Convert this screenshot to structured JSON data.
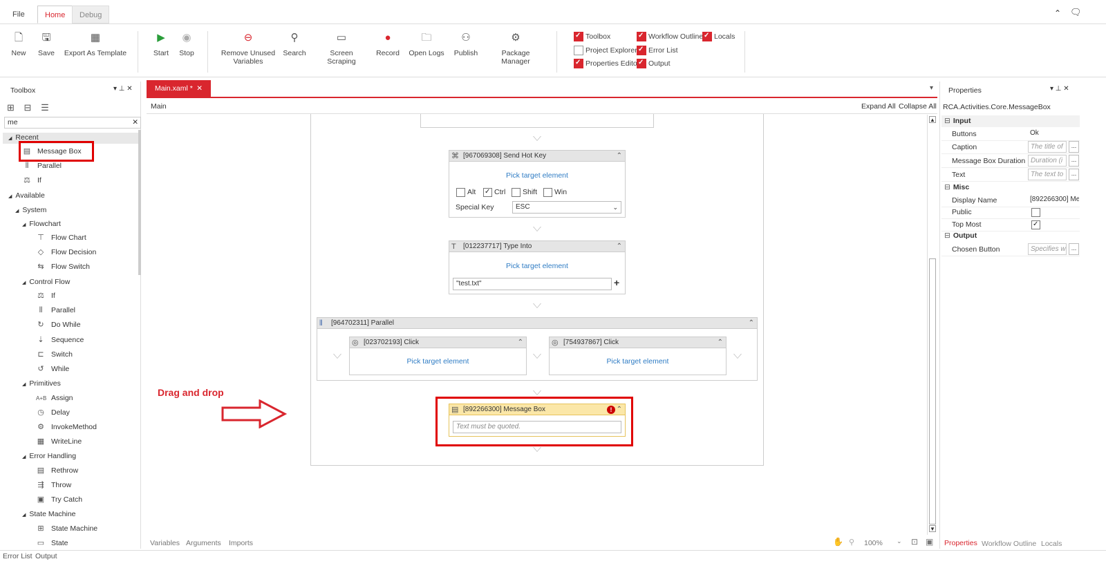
{
  "tabs": [
    {
      "label": "File"
    },
    {
      "label": "Home"
    },
    {
      "label": "Debug"
    }
  ],
  "ribbon": {
    "buttons": [
      {
        "label": "New",
        "icon": "new-file-icon"
      },
      {
        "label": "Save",
        "icon": "save-icon"
      },
      {
        "label": "Export As Template",
        "icon": "export-template-icon"
      },
      {
        "label": "Start",
        "icon": "play-icon"
      },
      {
        "label": "Stop",
        "icon": "stop-icon"
      },
      {
        "label": "Remove Unused Variables",
        "icon": "remove-icon"
      },
      {
        "label": "Search",
        "icon": "search-icon"
      },
      {
        "label": "Screen Scraping",
        "icon": "screen-scraping-icon"
      },
      {
        "label": "Record",
        "icon": "record-icon"
      },
      {
        "label": "Open Logs",
        "icon": "open-logs-icon"
      },
      {
        "label": "Publish",
        "icon": "publish-icon"
      },
      {
        "label": "Package Manager",
        "icon": "package-manager-icon"
      }
    ],
    "toggles": [
      {
        "label": "Toolbox",
        "checked": true
      },
      {
        "label": "Workflow Outline",
        "checked": true
      },
      {
        "label": "Locals",
        "checked": true
      },
      {
        "label": "Project Explorer",
        "checked": false
      },
      {
        "label": "Error List",
        "checked": true
      },
      {
        "label": "Properties Editor",
        "checked": true
      },
      {
        "label": "Output",
        "checked": true
      }
    ]
  },
  "toolbox": {
    "title": "Toolbox",
    "search_value": "me",
    "recent_label": "Recent",
    "recent": [
      {
        "label": "Message Box"
      },
      {
        "label": "Parallel"
      },
      {
        "label": "If"
      }
    ],
    "available_label": "Available",
    "system_label": "System",
    "flowchart_label": "Flowchart",
    "flowchart": [
      {
        "label": "Flow Chart"
      },
      {
        "label": "Flow Decision"
      },
      {
        "label": "Flow Switch"
      }
    ],
    "control_flow_label": "Control Flow",
    "control_flow": [
      {
        "label": "If"
      },
      {
        "label": "Parallel"
      },
      {
        "label": "Do While"
      },
      {
        "label": "Sequence"
      },
      {
        "label": "Switch"
      },
      {
        "label": "While"
      }
    ],
    "primitives_label": "Primitives",
    "primitives": [
      {
        "label": "Assign"
      },
      {
        "label": "Delay"
      },
      {
        "label": "InvokeMethod"
      },
      {
        "label": "WriteLine"
      }
    ],
    "error_handling_label": "Error Handling",
    "error_handling": [
      {
        "label": "Rethrow"
      },
      {
        "label": "Throw"
      },
      {
        "label": "Try Catch"
      }
    ],
    "state_machine_label": "State Machine",
    "state_machine": [
      {
        "label": "State Machine"
      },
      {
        "label": "State"
      }
    ]
  },
  "document": {
    "tab_label": "Main.xaml *",
    "breadcrumb": "Main",
    "expand_all": "Expand All",
    "collapse_all": "Collapse All"
  },
  "workflow": {
    "send_hot_key": {
      "title": "[967069308] Send Hot Key",
      "pick": "Pick target element",
      "alt": "Alt",
      "ctrl": "Ctrl",
      "shift": "Shift",
      "win": "Win",
      "special_key_label": "Special Key",
      "special_key_value": "ESC"
    },
    "type_into": {
      "title": "[012237717] Type Into",
      "pick": "Pick target element",
      "text_value": "\"test.txt\""
    },
    "parallel": {
      "title": "[964702311] Parallel",
      "click1": "[023702193] Click",
      "click2": "[754937867] Click",
      "pick": "Pick target element"
    },
    "message_box": {
      "title": "[892266300] Message Box",
      "placeholder": "Text must be quoted."
    },
    "annotation": "Drag and drop"
  },
  "bottom_tabs": [
    {
      "label": "Variables"
    },
    {
      "label": "Arguments"
    },
    {
      "label": "Imports"
    }
  ],
  "zoom": "100%",
  "output_tabs": [
    {
      "label": "Error List"
    },
    {
      "label": "Output"
    }
  ],
  "properties": {
    "title": "Properties",
    "type_name": "RCA.Activities.Core.MessageBox",
    "input_label": "Input",
    "buttons_label": "Buttons",
    "buttons_value": "Ok",
    "caption_label": "Caption",
    "caption_value": "The title of",
    "duration_label": "Message Box Duration",
    "duration_value": "Duration (i",
    "text_label": "Text",
    "text_value": "The text to",
    "misc_label": "Misc",
    "display_name_label": "Display Name",
    "display_name_value": "[892266300] Me",
    "public_label": "Public",
    "top_most_label": "Top Most",
    "output_label": "Output",
    "chosen_label": "Chosen Button",
    "chosen_value": "Specifies wh",
    "tabs": [
      {
        "label": "Properties"
      },
      {
        "label": "Workflow Outline"
      },
      {
        "label": "Locals"
      }
    ]
  },
  "colors": {
    "accent": "#d9262e",
    "link": "#2f7cc4",
    "warning_bg": "#fbe7a8"
  }
}
